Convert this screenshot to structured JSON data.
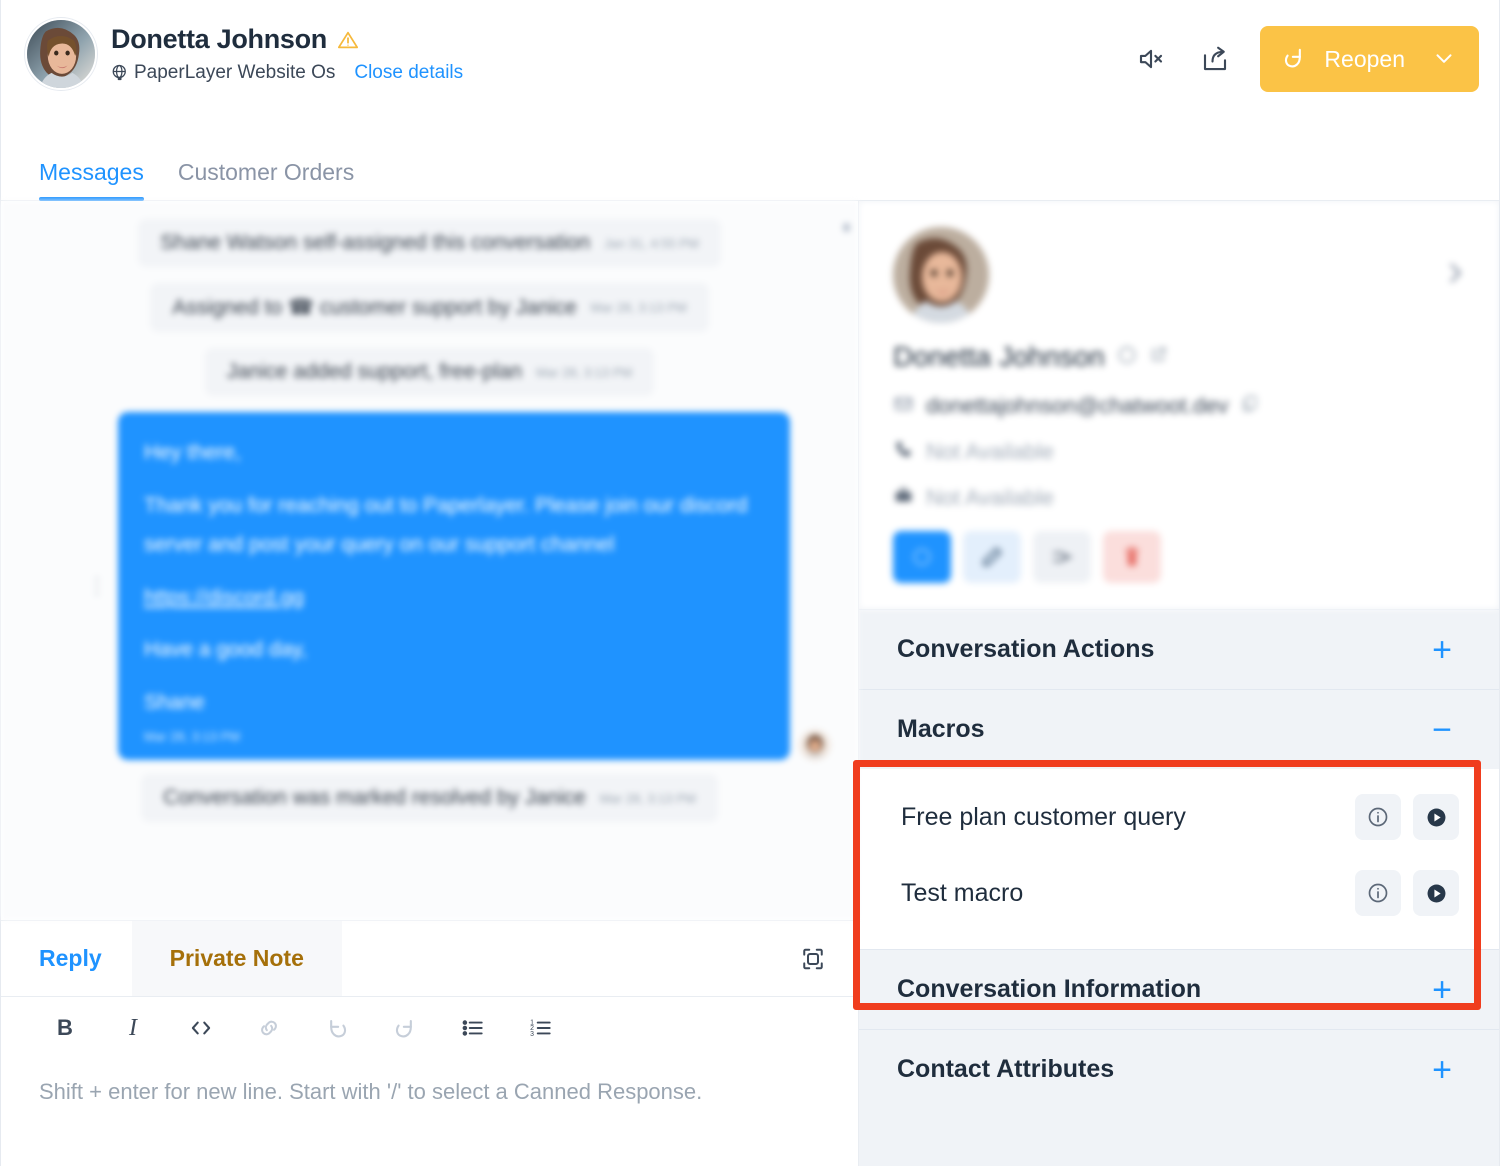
{
  "header": {
    "contact_name": "Donetta Johnson",
    "warning_icon": "warning-triangle-icon",
    "globe_icon": "globe-icon",
    "inbox_name": "PaperLayer Website Os",
    "close_details_label": "Close details",
    "mute_icon": "speaker-mute-icon",
    "share_icon": "share-export-icon",
    "reopen_label": "Reopen",
    "reopen_icon": "reopen-arrow-icon",
    "reopen_caret_icon": "chevron-down-icon",
    "reopen_color": "#FBC346"
  },
  "tabs": [
    {
      "label": "Messages",
      "active": true
    },
    {
      "label": "Customer Orders",
      "active": false
    }
  ],
  "messages": [
    {
      "type": "system",
      "text": "Shane Watson self-assigned this conversation",
      "time": "Jan 31, 4:55 PM"
    },
    {
      "type": "system",
      "text": "Assigned to ☎ customer support by Janice",
      "time": "Mar 28, 3:13 PM"
    },
    {
      "type": "system",
      "text": "Janice added support, free-plan",
      "time": "Mar 28, 3:13 PM"
    },
    {
      "type": "outgoing",
      "lines": [
        "Hey there,",
        "Thank you for reaching out to Paperlayer. Please join our discord server and post your query on our support channel",
        "https://discord.gg",
        "Have a good day,",
        "Shane"
      ],
      "time": "Mar 28, 3:13 PM"
    },
    {
      "type": "system",
      "text": "Conversation was marked resolved by Janice",
      "time": "Mar 28, 3:13 PM"
    }
  ],
  "reply": {
    "tabs": [
      {
        "label": "Reply",
        "active": true
      },
      {
        "label": "Private Note",
        "active": false
      }
    ],
    "expand_icon": "expand-editor-icon",
    "format_buttons": [
      {
        "name": "bold-button",
        "glyph": "B"
      },
      {
        "name": "italic-button",
        "glyph": "I"
      },
      {
        "name": "code-button",
        "glyph": "</>"
      },
      {
        "name": "link-button",
        "glyph": "⧉"
      },
      {
        "name": "undo-button",
        "glyph": "↶"
      },
      {
        "name": "redo-button",
        "glyph": "↷"
      },
      {
        "name": "bullet-list-button",
        "glyph": "☰"
      },
      {
        "name": "numbered-list-button",
        "glyph": "≡"
      }
    ],
    "placeholder": "Shift + enter for new line. Start with '/' to select a Canned Response."
  },
  "contact": {
    "name": "Donetta Johnson",
    "email": "donettajohnson@chatwoot.dev",
    "phone": "Not Available",
    "company": "Not Available",
    "email_icon": "mail-icon",
    "phone_icon": "phone-icon",
    "company_icon": "briefcase-icon",
    "copy_icon": "copy-icon",
    "external_link_icon": "external-link-icon",
    "status_icon": "status-dot-icon",
    "next_icon": "chevron-right-icon",
    "actions": [
      {
        "name": "new-conversation-button",
        "icon": "chat-icon",
        "style": "primary"
      },
      {
        "name": "edit-contact-button",
        "icon": "pencil-icon",
        "style": "edit"
      },
      {
        "name": "merge-contact-button",
        "icon": "merge-icon",
        "style": "merge"
      },
      {
        "name": "delete-contact-button",
        "icon": "trash-icon",
        "style": "del"
      }
    ]
  },
  "sidebar_sections": [
    {
      "title": "Conversation Actions",
      "toggle": "+",
      "expanded": false
    },
    {
      "title": "Macros",
      "toggle": "−",
      "expanded": true
    },
    {
      "title": "Conversation Information",
      "toggle": "+",
      "expanded": false
    },
    {
      "title": "Contact Attributes",
      "toggle": "+",
      "expanded": false
    }
  ],
  "macros": [
    {
      "name": "Free plan customer query",
      "info_icon": "info-icon",
      "run_icon": "play-icon"
    },
    {
      "name": "Test macro",
      "info_icon": "info-icon",
      "run_icon": "play-icon"
    }
  ],
  "highlight": {
    "color": "#F03D1E"
  }
}
